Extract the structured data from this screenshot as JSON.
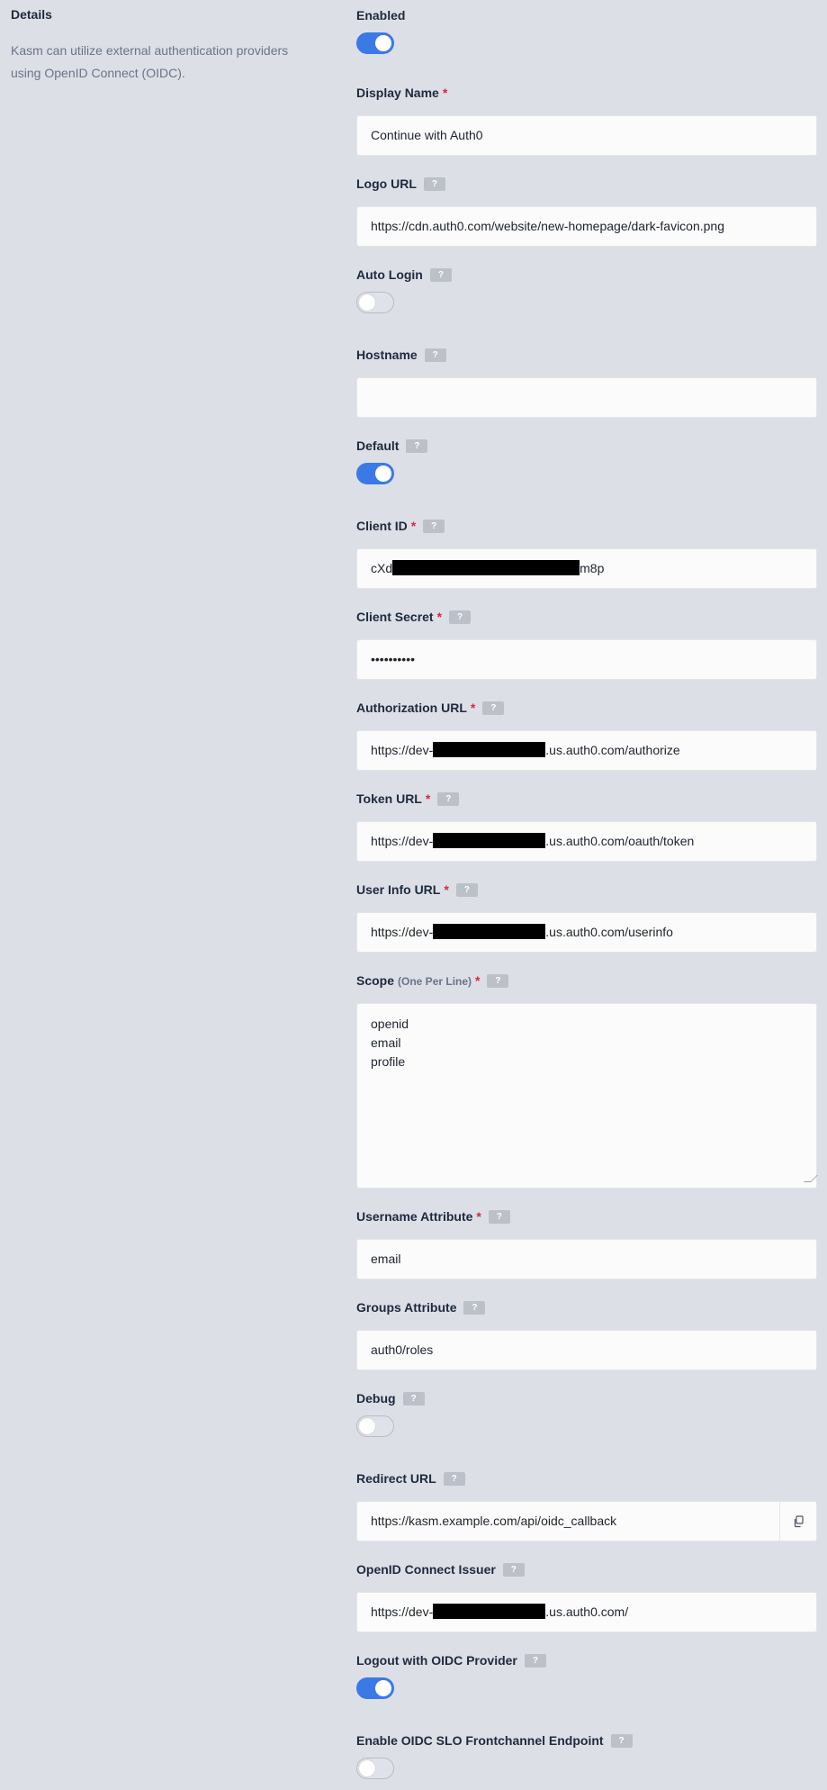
{
  "details": {
    "heading": "Details",
    "description": "Kasm can utilize external authentication providers using OpenID Connect (OIDC)."
  },
  "help_label": "?",
  "required_mark": "*",
  "fields": {
    "enabled": {
      "label": "Enabled",
      "value": true
    },
    "display_name": {
      "label": "Display Name",
      "value": "Continue with Auth0"
    },
    "logo_url": {
      "label": "Logo URL",
      "value": "https://cdn.auth0.com/website/new-homepage/dark-favicon.png"
    },
    "auto_login": {
      "label": "Auto Login",
      "value": false
    },
    "hostname": {
      "label": "Hostname",
      "value": ""
    },
    "default": {
      "label": "Default",
      "value": true
    },
    "client_id": {
      "label": "Client ID",
      "value_prefix": "cXd",
      "value_suffix": "m8p"
    },
    "client_secret": {
      "label": "Client Secret",
      "value": "••••••••••"
    },
    "authorization_url": {
      "label": "Authorization URL",
      "value_prefix": "https://dev-",
      "value_suffix": ".us.auth0.com/authorize"
    },
    "token_url": {
      "label": "Token URL",
      "value_prefix": "https://dev-",
      "value_suffix": ".us.auth0.com/oauth/token"
    },
    "user_info_url": {
      "label": "User Info URL",
      "value_prefix": "https://dev-",
      "value_suffix": ".us.auth0.com/userinfo"
    },
    "scope": {
      "label": "Scope",
      "sublabel": "(One Per Line)",
      "lines": [
        "openid",
        "email",
        "profile"
      ]
    },
    "username_attribute": {
      "label": "Username Attribute",
      "value": "email"
    },
    "groups_attribute": {
      "label": "Groups Attribute",
      "value": "auth0/roles"
    },
    "debug": {
      "label": "Debug",
      "value": false
    },
    "redirect_url": {
      "label": "Redirect URL",
      "value": "https://kasm.example.com/api/oidc_callback"
    },
    "openid_issuer": {
      "label": "OpenID Connect Issuer",
      "value_prefix": "https://dev-",
      "value_suffix": ".us.auth0.com/"
    },
    "logout_oidc": {
      "label": "Logout with OIDC Provider",
      "value": true
    },
    "slo_frontchannel": {
      "label": "Enable OIDC SLO Frontchannel Endpoint",
      "value": false
    }
  },
  "colors": {
    "accent": "#3b7ae6",
    "required": "#d8273f",
    "background": "#dcdfe6"
  },
  "icons": {
    "copy": "copy-icon",
    "help": "help-badge"
  }
}
